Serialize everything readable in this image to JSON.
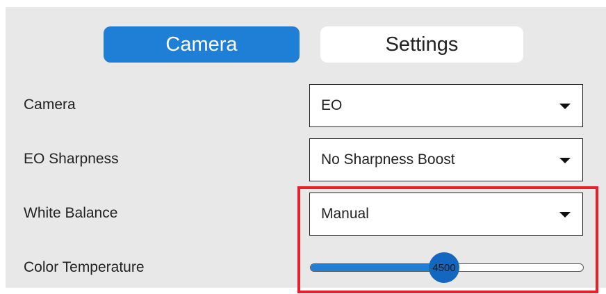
{
  "tabs": {
    "camera_label": "Camera",
    "settings_label": "Settings"
  },
  "rows": {
    "camera": {
      "label": "Camera",
      "value": "EO",
      "icon": "caret-down-icon"
    },
    "eo_sharpness": {
      "label": "EO Sharpness",
      "value": "No Sharpness Boost",
      "icon": "caret-down-icon"
    },
    "white_balance": {
      "label": "White Balance",
      "value": "Manual",
      "icon": "caret-down-icon"
    },
    "color_temperature": {
      "label": "Color Temperature",
      "value": "4500",
      "fill_fraction": 0.49
    }
  },
  "colors": {
    "accent": "#1f7ed6",
    "highlight": "#e8202a",
    "panel": "#e8e8e8"
  }
}
